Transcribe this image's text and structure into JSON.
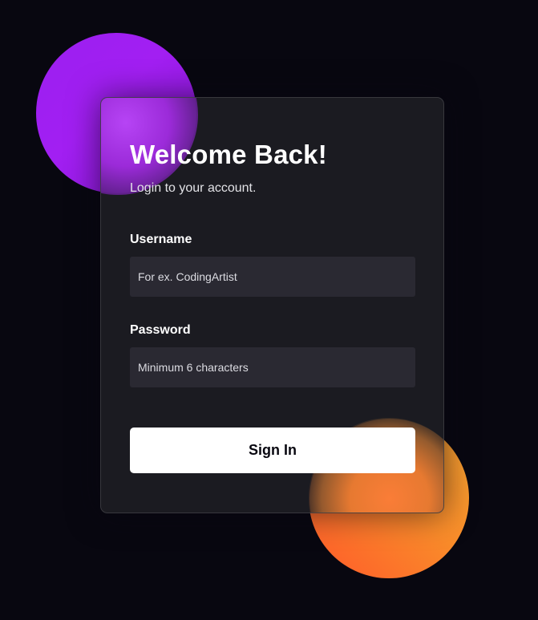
{
  "login": {
    "title": "Welcome Back!",
    "subtitle": "Login to your account.",
    "username_label": "Username",
    "username_placeholder": "For ex. CodingArtist",
    "username_value": "",
    "password_label": "Password",
    "password_placeholder": "Minimum 6 characters",
    "password_value": "",
    "submit_label": "Sign In"
  },
  "colors": {
    "background": "#080710",
    "card": "#1e1e24",
    "input": "#2a2932",
    "button": "#ffffff",
    "orb_purple": "#a21ff2",
    "orb_orange": "#f98b2a"
  }
}
